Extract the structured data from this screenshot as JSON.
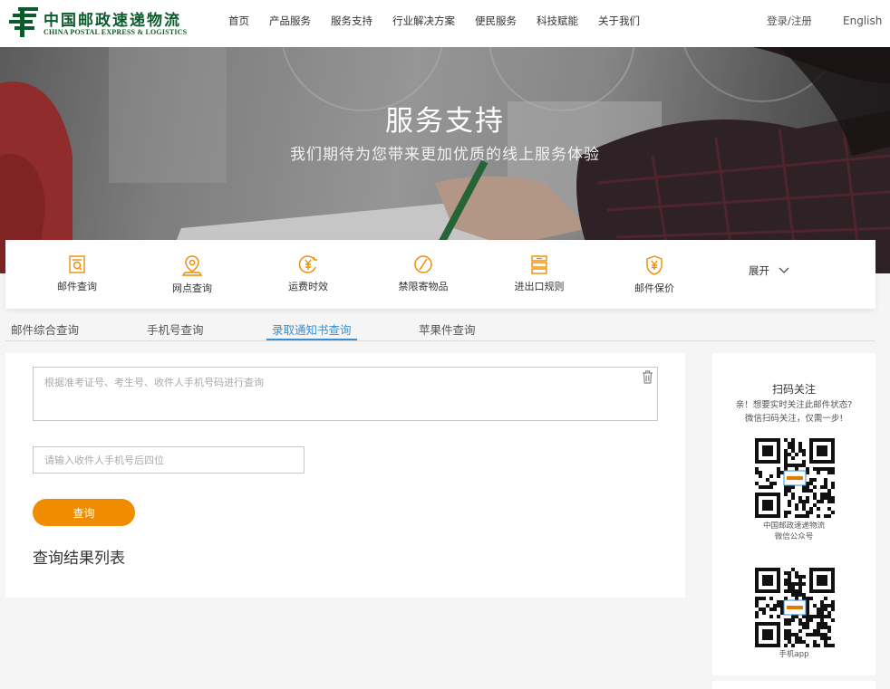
{
  "header": {
    "logo_cn": "中国邮政速递物流",
    "logo_en": "CHINA POSTAL EXPRESS & LOGISTICS",
    "nav": [
      "首页",
      "产品服务",
      "服务支持",
      "行业解决方案",
      "便民服务",
      "科技赋能",
      "关于我们"
    ],
    "login": "登录/注册",
    "language": "English"
  },
  "hero": {
    "title": "服务支持",
    "subtitle": "我们期待为您带来更加优质的线上服务体验"
  },
  "services": {
    "items": [
      {
        "label": "邮件查询",
        "icon": "search-doc-icon"
      },
      {
        "label": "网点查询",
        "icon": "location-pin-icon"
      },
      {
        "label": "运费时效",
        "icon": "yuan-clock-icon"
      },
      {
        "label": "禁限寄物品",
        "icon": "prohibited-icon"
      },
      {
        "label": "进出口规则",
        "icon": "rules-icon"
      },
      {
        "label": "邮件保价",
        "icon": "shield-yuan-icon"
      }
    ],
    "expand": "展开"
  },
  "tabs": [
    "邮件综合查询",
    "手机号查询",
    "录取通知书查询",
    "苹果件查询"
  ],
  "form": {
    "textarea_placeholder": "根据准考证号、考生号、收件人手机号码进行查询",
    "phone_placeholder": "请输入收件人手机号后四位",
    "query_button": "查询",
    "result_title": "查询结果列表"
  },
  "sidebar": {
    "title": "扫码关注",
    "desc_line1": "亲！想要实时关注此邮件状态?",
    "desc_line2": "微信扫码关注，仅需一步!",
    "qr1_caption_line1": "中国邮政速递物流",
    "qr1_caption_line2": "微信公众号",
    "qr2_caption": "手机app"
  },
  "colors": {
    "brand_green": "#0a5c2c",
    "accent_orange": "#f08c00",
    "tab_active": "#3a8fd0"
  }
}
